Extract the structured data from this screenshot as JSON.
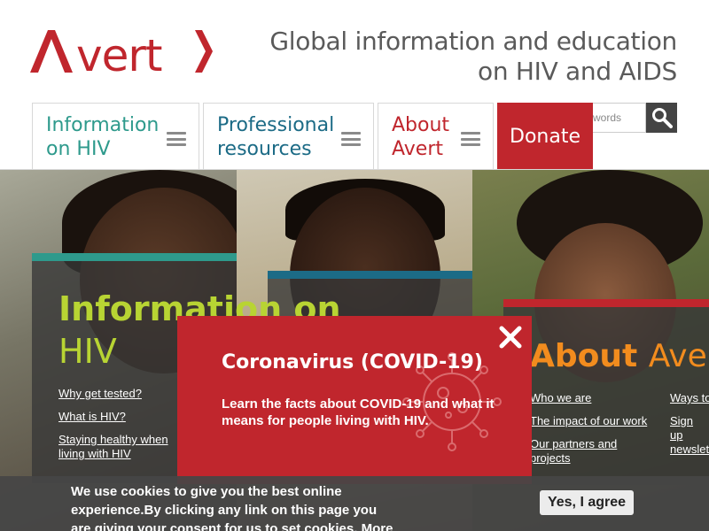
{
  "brand": {
    "name": "Avert",
    "accent": "#c0262d",
    "teal": "#2e9a8c",
    "blue": "#1c6b86"
  },
  "header": {
    "tagline": "Global information and education on HIV and AIDS"
  },
  "nav": {
    "tabs": [
      {
        "label": "Information on HIV",
        "icon": "hamburger-menu-icon"
      },
      {
        "label": "Professional resources",
        "icon": "hamburger-menu-icon"
      },
      {
        "label": "About Avert",
        "icon": "hamburger-menu-icon"
      }
    ],
    "donate_label": "Donate",
    "search_placeholder": "words",
    "search_icon": "search-icon"
  },
  "hero": {
    "panel1": {
      "title_line1": "Information on",
      "title_line2": "HIV",
      "links": [
        "Why get tested?",
        "What is HIV?",
        "Staying healthy when living with HIV"
      ]
    },
    "panel3": {
      "title_word1": "About",
      "title_word2": "Avert",
      "links_left": [
        "Who we are",
        "The impact of our work",
        "Our partners and projects"
      ],
      "links_right": [
        "Ways to",
        "Sign up newslet"
      ]
    }
  },
  "modal": {
    "title": "Coronavirus (COVID-19)",
    "body": "Learn the facts about COVID-19 and what it means for people living with HIV.",
    "close_icon": "close-icon"
  },
  "cookie": {
    "text": "We use cookies to give you the best online experience.By clicking any link on this page you are giving your consent for us to set cookies. More info",
    "agree_label": "Yes, I agree"
  }
}
